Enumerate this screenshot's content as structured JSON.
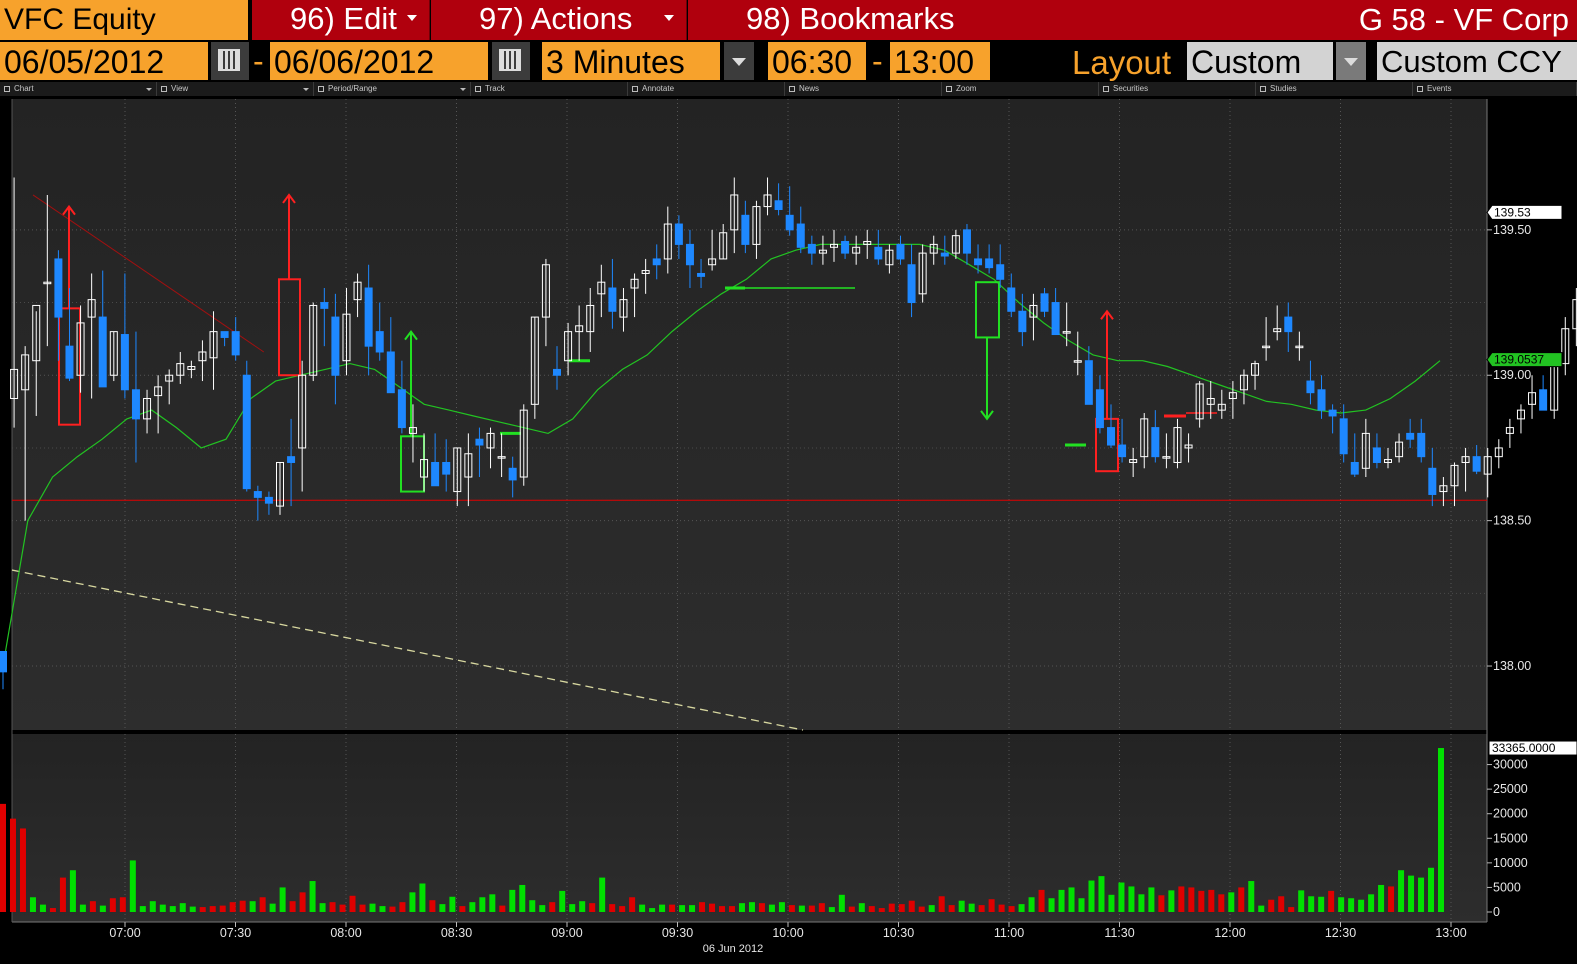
{
  "header": {
    "ticker": "VFC Equity",
    "menu_edit": "96) Edit",
    "menu_actions": "97) Actions",
    "menu_bookmarks": "98) Bookmarks",
    "security_name": "G 58 - VF Corp"
  },
  "controls": {
    "start_date": "06/05/2012",
    "end_date": "06/06/2012",
    "date_separator": "-",
    "period": "3 Minutes",
    "start_time": "06:30",
    "time_separator": "-",
    "end_time": "13:00",
    "layout_label": "Layout",
    "layout_value": "Custom",
    "currency": "Custom CCY"
  },
  "toolbar": [
    "Chart",
    "View",
    "Period/Range",
    "Track",
    "Annotate",
    "News",
    "Zoom",
    "Securities",
    "Studies",
    "Events"
  ],
  "colors": {
    "up_candle": "#ffffff",
    "down_candle": "#1e88ff",
    "moving_average": "#22c322",
    "volume_up": "#00e000",
    "volume_down": "#e00000",
    "support_line": "#e00000",
    "orange_accent": "#f7a22c",
    "menu_red": "#b0000d"
  },
  "chart_data": [
    {
      "type": "candlestick",
      "x_ticks": [
        "07:00",
        "07:30",
        "08:00",
        "08:30",
        "09:00",
        "09:30",
        "10:00",
        "10:30",
        "11:00",
        "11:30",
        "12:00",
        "12:30",
        "13:00"
      ],
      "x_date_label": "06 Jun 2012",
      "y_ticks": [
        "139.50",
        "139.00",
        "138.50",
        "138.00"
      ],
      "ylim": [
        137.78,
        139.95
      ],
      "last_price_label": "139.53",
      "moving_average_label": "139.0537",
      "support_level": 138.57,
      "grid": true,
      "ohlc": [
        [
          138.05,
          138.05,
          137.92,
          137.98
        ],
        [
          138.92,
          139.68,
          138.82,
          139.02
        ],
        [
          138.95,
          139.1,
          138.5,
          139.07
        ],
        [
          139.05,
          139.22,
          138.86,
          139.24
        ],
        [
          139.32,
          139.62,
          139.1,
          139.32
        ],
        [
          139.4,
          139.43,
          139.05,
          139.2
        ],
        [
          139.1,
          139.3,
          138.98,
          138.99
        ],
        [
          139.0,
          139.24,
          138.94,
          139.18
        ],
        [
          139.2,
          139.35,
          138.92,
          139.26
        ],
        [
          139.2,
          139.36,
          138.98,
          138.96
        ],
        [
          139.0,
          139.15,
          138.98,
          139.15
        ],
        [
          139.14,
          139.35,
          138.92,
          138.95
        ],
        [
          138.95,
          139.15,
          138.7,
          138.85
        ],
        [
          138.85,
          138.95,
          138.8,
          138.92
        ],
        [
          138.93,
          139.0,
          138.8,
          138.96
        ],
        [
          138.98,
          139.02,
          138.9,
          139.0
        ],
        [
          139.0,
          139.08,
          138.97,
          139.04
        ],
        [
          139.02,
          139.05,
          138.99,
          139.03
        ],
        [
          139.05,
          139.12,
          138.98,
          139.08
        ],
        [
          139.06,
          139.22,
          138.95,
          139.15
        ],
        [
          139.15,
          139.15,
          139.1,
          139.13
        ],
        [
          139.15,
          139.2,
          139.05,
          139.07
        ],
        [
          139.0,
          139.05,
          138.6,
          138.61
        ],
        [
          138.6,
          138.62,
          138.5,
          138.58
        ],
        [
          138.58,
          138.6,
          138.52,
          138.56
        ],
        [
          138.55,
          138.7,
          138.52,
          138.7
        ],
        [
          138.72,
          138.85,
          138.55,
          138.7
        ],
        [
          138.75,
          139.05,
          138.6,
          139.0
        ],
        [
          139.0,
          139.25,
          138.98,
          139.24
        ],
        [
          139.25,
          139.3,
          139.1,
          139.23
        ],
        [
          139.2,
          139.28,
          138.9,
          139.0
        ],
        [
          139.05,
          139.3,
          139.0,
          139.21
        ],
        [
          139.26,
          139.35,
          139.2,
          139.32
        ],
        [
          139.3,
          139.38,
          139.0,
          139.1
        ],
        [
          139.15,
          139.25,
          139.05,
          139.08
        ],
        [
          139.08,
          139.2,
          139.0,
          138.94
        ],
        [
          138.95,
          139.05,
          138.8,
          138.82
        ],
        [
          138.8,
          138.9,
          138.7,
          138.82
        ],
        [
          138.65,
          138.8,
          138.6,
          138.71
        ],
        [
          138.7,
          138.8,
          138.65,
          138.62
        ],
        [
          138.7,
          138.78,
          138.6,
          138.66
        ],
        [
          138.6,
          138.75,
          138.55,
          138.75
        ],
        [
          138.65,
          138.8,
          138.55,
          138.73
        ],
        [
          138.78,
          138.82,
          138.65,
          138.76
        ],
        [
          138.75,
          138.82,
          138.68,
          138.8
        ],
        [
          138.72,
          138.8,
          138.65,
          138.72
        ],
        [
          138.68,
          138.72,
          138.58,
          138.64
        ],
        [
          138.65,
          138.9,
          138.62,
          138.88
        ],
        [
          138.9,
          139.2,
          138.85,
          139.2
        ],
        [
          139.2,
          139.4,
          139.1,
          139.38
        ],
        [
          139.02,
          139.1,
          138.95,
          139.0
        ],
        [
          139.05,
          139.18,
          139.0,
          139.15
        ],
        [
          139.15,
          139.24,
          139.05,
          139.17
        ],
        [
          139.15,
          139.3,
          139.08,
          139.24
        ],
        [
          139.28,
          139.38,
          139.2,
          139.32
        ],
        [
          139.3,
          139.4,
          139.16,
          139.22
        ],
        [
          139.2,
          139.3,
          139.15,
          139.26
        ],
        [
          139.3,
          139.35,
          139.2,
          139.33
        ],
        [
          139.35,
          139.4,
          139.28,
          139.36
        ],
        [
          139.4,
          139.45,
          139.33,
          139.38
        ],
        [
          139.4,
          139.58,
          139.35,
          139.52
        ],
        [
          139.52,
          139.55,
          139.4,
          139.45
        ],
        [
          139.45,
          139.5,
          139.3,
          139.38
        ],
        [
          139.35,
          139.4,
          139.3,
          139.34
        ],
        [
          139.38,
          139.5,
          139.36,
          139.4
        ],
        [
          139.4,
          139.52,
          139.4,
          139.49
        ],
        [
          139.5,
          139.68,
          139.42,
          139.62
        ],
        [
          139.55,
          139.6,
          139.42,
          139.45
        ],
        [
          139.45,
          139.6,
          139.4,
          139.58
        ],
        [
          139.58,
          139.68,
          139.55,
          139.62
        ],
        [
          139.6,
          139.66,
          139.55,
          139.57
        ],
        [
          139.55,
          139.65,
          139.48,
          139.5
        ],
        [
          139.52,
          139.58,
          139.42,
          139.44
        ],
        [
          139.45,
          139.48,
          139.38,
          139.42
        ],
        [
          139.42,
          139.48,
          139.38,
          139.43
        ],
        [
          139.44,
          139.5,
          139.39,
          139.45
        ],
        [
          139.46,
          139.48,
          139.4,
          139.42
        ],
        [
          139.42,
          139.48,
          139.38,
          139.44
        ],
        [
          139.45,
          139.5,
          139.4,
          139.46
        ],
        [
          139.44,
          139.5,
          139.38,
          139.4
        ],
        [
          139.38,
          139.45,
          139.35,
          139.43
        ],
        [
          139.45,
          139.48,
          139.38,
          139.4
        ],
        [
          139.38,
          139.45,
          139.2,
          139.25
        ],
        [
          139.28,
          139.45,
          139.25,
          139.42
        ],
        [
          139.42,
          139.48,
          139.38,
          139.45
        ],
        [
          139.42,
          139.48,
          139.38,
          139.41
        ],
        [
          139.42,
          139.5,
          139.4,
          139.48
        ],
        [
          139.5,
          139.52,
          139.38,
          139.42
        ],
        [
          139.4,
          139.45,
          139.35,
          139.38
        ],
        [
          139.4,
          139.45,
          139.35,
          139.37
        ],
        [
          139.38,
          139.45,
          139.3,
          139.33
        ],
        [
          139.3,
          139.35,
          139.2,
          139.22
        ],
        [
          139.22,
          139.28,
          139.1,
          139.15
        ],
        [
          139.2,
          139.28,
          139.12,
          139.24
        ],
        [
          139.28,
          139.3,
          139.2,
          139.22
        ],
        [
          139.25,
          139.3,
          139.14,
          139.14
        ],
        [
          139.15,
          139.25,
          139.1,
          139.15
        ],
        [
          139.05,
          139.15,
          139.0,
          139.05
        ],
        [
          139.05,
          139.1,
          138.95,
          138.9
        ],
        [
          138.95,
          139.0,
          138.8,
          138.82
        ],
        [
          138.82,
          138.9,
          138.75,
          138.76
        ],
        [
          138.76,
          138.85,
          138.7,
          138.72
        ],
        [
          138.7,
          138.75,
          138.65,
          138.71
        ],
        [
          138.72,
          138.87,
          138.68,
          138.85
        ],
        [
          138.82,
          138.88,
          138.7,
          138.72
        ],
        [
          138.72,
          138.8,
          138.68,
          138.72
        ],
        [
          138.7,
          138.85,
          138.68,
          138.82
        ],
        [
          138.75,
          138.8,
          138.7,
          138.76
        ],
        [
          138.85,
          138.98,
          138.82,
          138.97
        ],
        [
          138.9,
          138.98,
          138.85,
          138.92
        ],
        [
          138.88,
          138.95,
          138.85,
          138.9
        ],
        [
          138.92,
          138.98,
          138.85,
          138.94
        ],
        [
          138.95,
          139.02,
          138.9,
          139.0
        ],
        [
          139.0,
          139.05,
          138.95,
          139.04
        ],
        [
          139.1,
          139.2,
          139.05,
          139.1
        ],
        [
          139.15,
          139.24,
          139.12,
          139.16
        ],
        [
          139.2,
          139.25,
          139.08,
          139.15
        ],
        [
          139.1,
          139.15,
          139.05,
          139.1
        ],
        [
          138.98,
          139.05,
          138.9,
          138.94
        ],
        [
          138.95,
          139.0,
          138.85,
          138.88
        ],
        [
          138.88,
          138.9,
          138.8,
          138.86
        ],
        [
          138.85,
          138.9,
          138.7,
          138.73
        ],
        [
          138.7,
          138.8,
          138.65,
          138.66
        ],
        [
          138.68,
          138.85,
          138.65,
          138.8
        ],
        [
          138.75,
          138.8,
          138.68,
          138.7
        ],
        [
          138.7,
          138.75,
          138.68,
          138.71
        ],
        [
          138.72,
          138.8,
          138.7,
          138.77
        ],
        [
          138.8,
          138.85,
          138.75,
          138.78
        ],
        [
          138.8,
          138.85,
          138.7,
          138.72
        ],
        [
          138.68,
          138.75,
          138.55,
          138.59
        ],
        [
          138.6,
          138.65,
          138.55,
          138.62
        ],
        [
          138.62,
          138.7,
          138.55,
          138.69
        ],
        [
          138.7,
          138.75,
          138.6,
          138.72
        ],
        [
          138.72,
          138.76,
          138.66,
          138.67
        ],
        [
          138.66,
          138.75,
          138.58,
          138.72
        ],
        [
          138.72,
          138.78,
          138.68,
          138.75
        ],
        [
          138.8,
          138.85,
          138.75,
          138.82
        ],
        [
          138.85,
          138.9,
          138.8,
          138.88
        ],
        [
          138.9,
          139.0,
          138.85,
          138.94
        ],
        [
          138.95,
          139.0,
          138.9,
          138.88
        ],
        [
          138.88,
          139.05,
          138.85,
          139.04
        ],
        [
          139.04,
          139.2,
          139.0,
          139.16
        ],
        [
          139.16,
          139.3,
          139.1,
          139.26
        ],
        [
          139.28,
          139.35,
          139.2,
          139.3
        ],
        [
          139.3,
          139.42,
          139.25,
          139.32
        ],
        [
          139.35,
          139.48,
          139.2,
          139.24
        ],
        [
          139.25,
          139.55,
          139.2,
          139.52
        ],
        [
          139.52,
          139.6,
          139.3,
          139.33
        ],
        [
          139.35,
          139.6,
          139.3,
          139.53
        ]
      ],
      "moving_average": [
        138.0,
        138.5,
        138.65,
        138.72,
        138.78,
        138.85,
        138.88,
        138.82,
        138.75,
        138.78,
        138.92,
        138.98,
        139.0,
        139.02,
        139.04,
        139.02,
        138.96,
        138.9,
        138.88,
        138.86,
        138.84,
        138.82,
        138.8,
        138.85,
        138.95,
        139.02,
        139.07,
        139.15,
        139.22,
        139.28,
        139.33,
        139.4,
        139.43,
        139.45,
        139.45,
        139.45,
        139.45,
        139.45,
        139.43,
        139.38,
        139.33,
        139.25,
        139.18,
        139.12,
        139.07,
        139.05,
        139.05,
        139.03,
        139.0,
        138.97,
        138.94,
        138.91,
        138.9,
        138.88,
        138.87,
        138.88,
        138.92,
        138.98,
        139.05
      ],
      "annotations": {
        "trendline": {
          "from": [
            0,
            139.62
          ],
          "to": [
            10,
            139.08
          ]
        },
        "dashed_trendline": {
          "from": [
            0,
            138.33
          ],
          "to": [
            30,
            137.78
          ]
        },
        "support_line": 138.57
      }
    },
    {
      "type": "bar",
      "title": "Volume",
      "y_ticks": [
        "30000",
        "25000",
        "20000",
        "15000",
        "10000",
        "5000",
        "0"
      ],
      "ylim": [
        0,
        35000
      ],
      "last_value_label": "33365.0000",
      "values_up_down": "green = up bar, red = down bar",
      "values": [
        22000,
        19000,
        17000,
        3000,
        1500,
        800,
        7000,
        8500,
        1500,
        2200,
        1300,
        2800,
        3000,
        10500,
        1200,
        2200,
        1500,
        1200,
        1800,
        1100,
        1000,
        1200,
        1300,
        2000,
        2300,
        2200,
        3000,
        1700,
        5000,
        2200,
        4000,
        6300,
        1800,
        2000,
        1500,
        3300,
        1500,
        1700,
        1200,
        1100,
        2000,
        4000,
        5800,
        2400,
        1600,
        3100,
        1200,
        2000,
        3000,
        3600,
        1300,
        4500,
        5500,
        2400,
        1400,
        2000,
        4300,
        1600,
        2200,
        1800,
        7000,
        1600,
        1200,
        3000,
        1500,
        800,
        1500,
        1500,
        1400,
        1400,
        2000,
        1700,
        1200,
        1200,
        1800,
        2000,
        1800,
        1500,
        2000,
        1400,
        1300,
        1300,
        1800,
        1000,
        3500,
        1100,
        1800,
        1200,
        800,
        1700,
        1600,
        2300,
        1100,
        1400,
        3200,
        1400,
        2300,
        1700,
        1400,
        2600,
        1500,
        1200,
        1600,
        3000,
        4500,
        2800,
        4500,
        5000,
        2800,
        6400,
        7300,
        3500,
        6000,
        5200,
        3600,
        5000,
        3400,
        4400,
        5200,
        5000,
        4300,
        4500,
        3600,
        4000,
        5000,
        6300,
        1300,
        2500,
        3200,
        1000,
        4400,
        3200,
        3100,
        4300,
        3000,
        2800,
        2500,
        3600,
        5500,
        5200,
        8500,
        7400,
        7000,
        9000,
        33365
      ]
    }
  ]
}
